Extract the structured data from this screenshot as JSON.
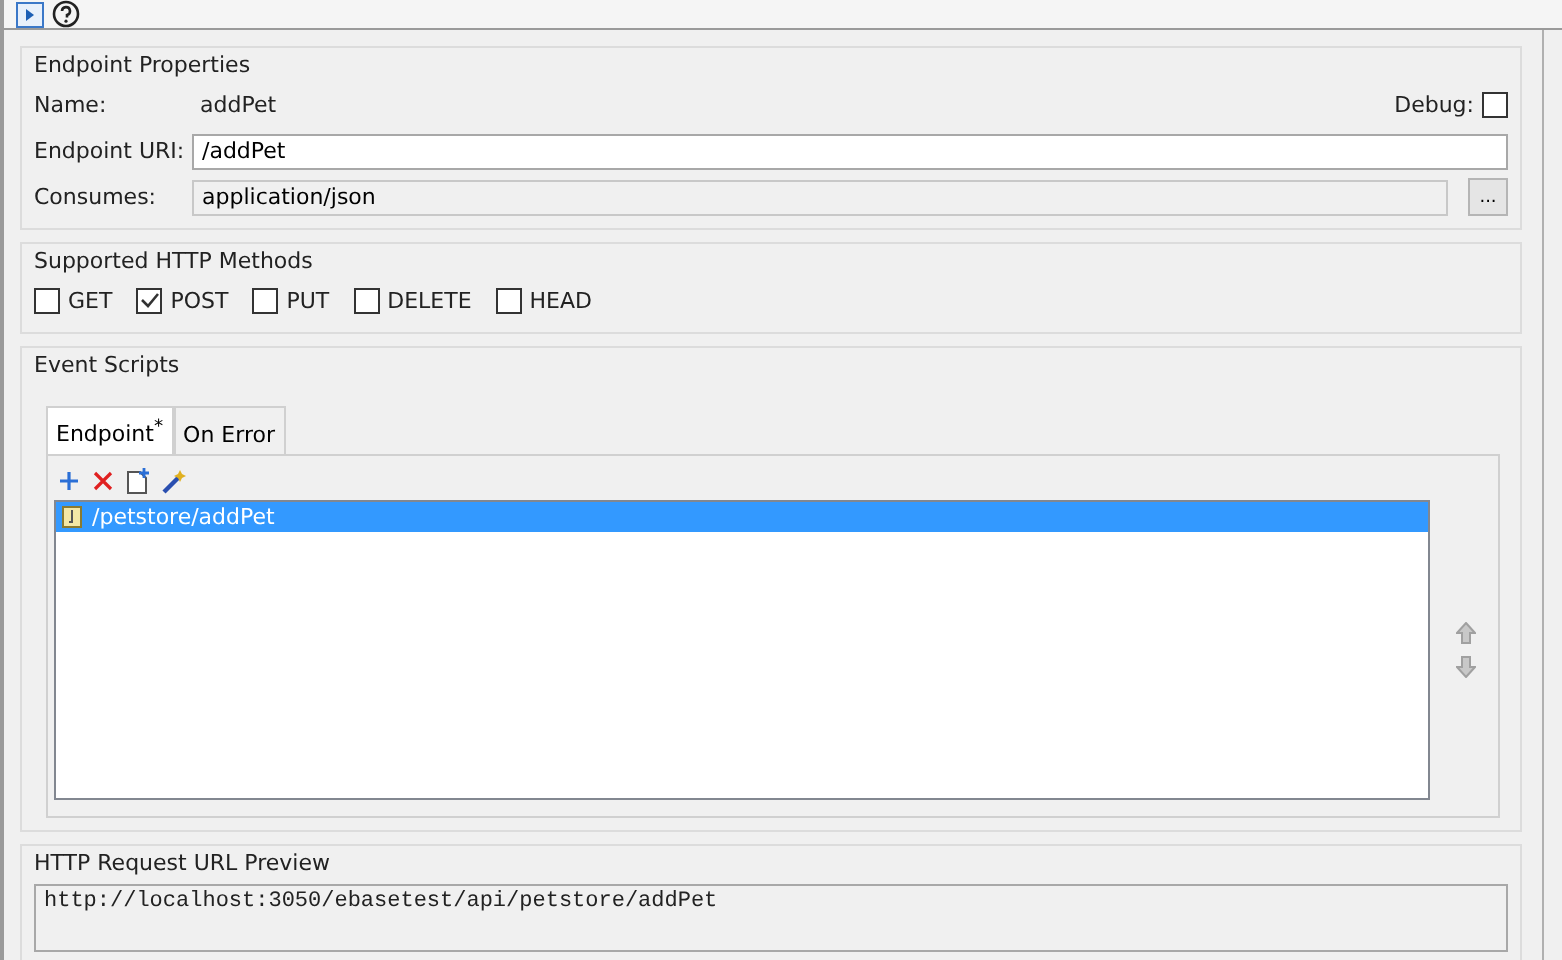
{
  "toolbar": {
    "buttons": [
      {
        "kind": "run"
      },
      {
        "kind": "help"
      }
    ]
  },
  "endpoint_properties": {
    "title": "Endpoint Properties",
    "name_label": "Name:",
    "name_value": "addPet",
    "debug_label": "Debug:",
    "debug_checked": false,
    "uri_label": "Endpoint URI:",
    "uri_value": "/addPet",
    "consumes_label": "Consumes:",
    "consumes_value": "application/json",
    "browse_button": "..."
  },
  "http_methods": {
    "title": "Supported HTTP Methods",
    "methods": [
      {
        "label": "GET",
        "checked": false
      },
      {
        "label": "POST",
        "checked": true
      },
      {
        "label": "PUT",
        "checked": false
      },
      {
        "label": "DELETE",
        "checked": false
      },
      {
        "label": "HEAD",
        "checked": false
      }
    ]
  },
  "event_scripts": {
    "title": "Event Scripts",
    "tabs": [
      {
        "label": "Endpoint$^{*}$",
        "selected": true
      },
      {
        "label": "On Error",
        "selected": false
      }
    ],
    "scripts": [
      {
        "label": "/petstore/addPet",
        "selected": true
      }
    ]
  },
  "url_preview": {
    "title": "HTTP Request URL Preview",
    "value": "http://localhost:3050/ebasetest/api/petstore/addPet"
  }
}
